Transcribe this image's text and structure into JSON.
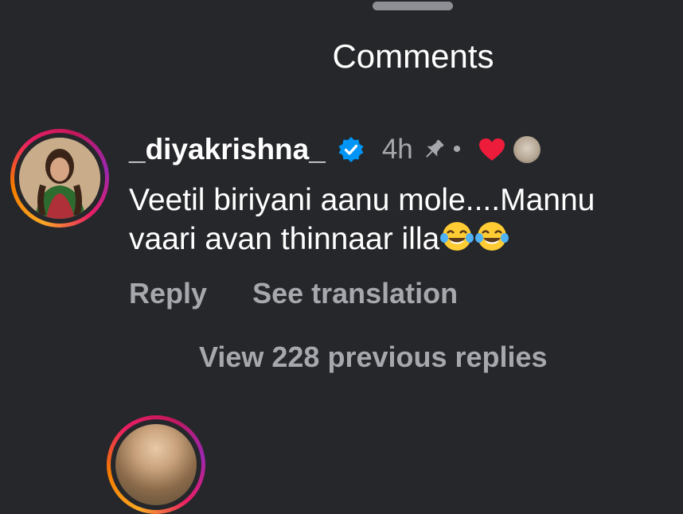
{
  "sheet": {
    "title": "Comments"
  },
  "comment": {
    "username": "_diyakrishna_",
    "time": "4h",
    "separator": "•",
    "text": "Veetil biriyani aanu mole....Mannu vaari avan thinnaar illa",
    "emojis": [
      "face-with-tears-of-joy",
      "face-with-tears-of-joy"
    ],
    "actions": {
      "reply": "Reply",
      "see_translation": "See translation"
    }
  },
  "replies": {
    "view_label": "View 228 previous replies"
  },
  "colors": {
    "background": "#26272b",
    "text_primary": "#ffffff",
    "text_secondary": "#a7a8ad",
    "verified": "#0095f6",
    "heart": "#ed1c3a"
  }
}
